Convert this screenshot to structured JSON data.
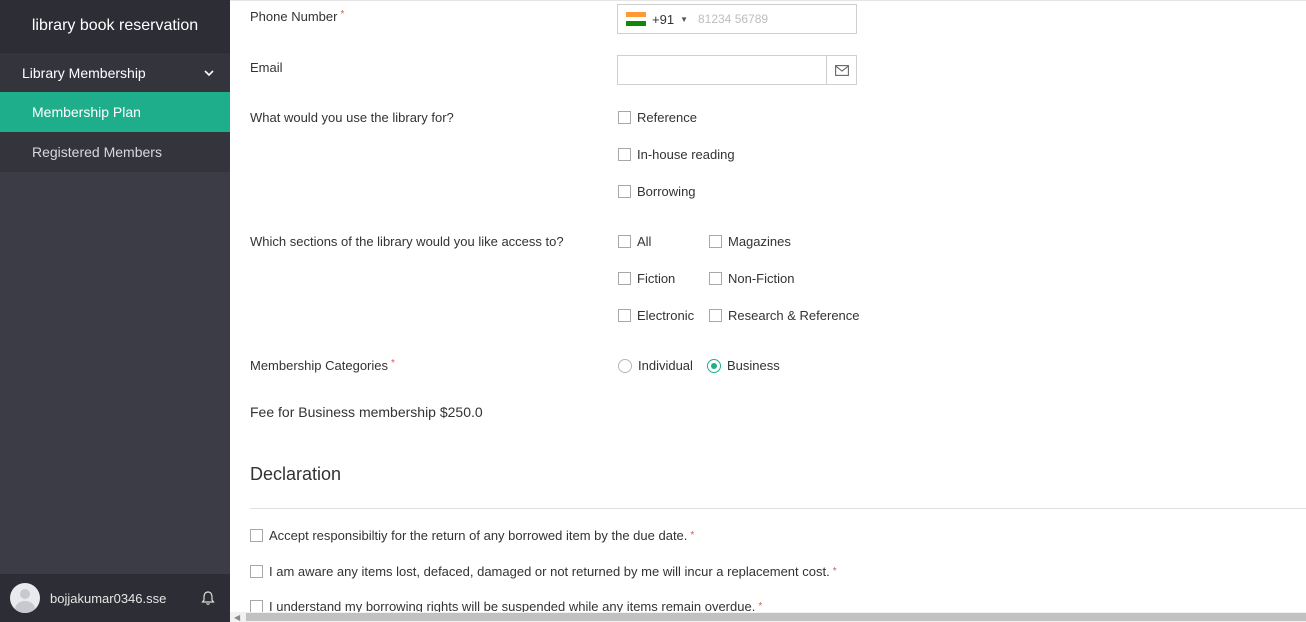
{
  "app": {
    "title": "library book reservation"
  },
  "sidebar": {
    "group_label": "Library Membership",
    "items": [
      {
        "label": "Membership Plan",
        "active": true
      },
      {
        "label": "Registered Members",
        "active": false
      }
    ],
    "user": "bojjakumar0346.sse"
  },
  "form": {
    "phone": {
      "label": "Phone Number",
      "required": "*",
      "country_code": "+91",
      "placeholder": "81234 56789"
    },
    "email": {
      "label": "Email",
      "value": ""
    },
    "use": {
      "label": "What would you use the library for?",
      "options": [
        "Reference",
        "In-house reading",
        "Borrowing"
      ]
    },
    "sections": {
      "label": "Which sections of the library would you like access to?",
      "options": [
        "All",
        "Magazines",
        "Fiction",
        "Non-Fiction",
        "Electronic",
        "Research & Reference"
      ]
    },
    "membership": {
      "label": "Membership Categories",
      "required": "*",
      "options": [
        "Individual",
        "Business"
      ],
      "selected": "Business"
    },
    "fee_text": "Fee for Business membership $250.0"
  },
  "declaration": {
    "title": "Declaration",
    "items": [
      "Accept responsibiltiy for the return of any borrowed item by the due date.",
      "I am aware any items lost, defaced, damaged or not returned by me will incur a replacement cost.",
      "I understand my borrowing rights will be suspended while any items remain overdue."
    ],
    "required": "*"
  },
  "colors": {
    "accent": "#1fae8c",
    "sidebar_bg": "#3c3c46",
    "sidebar_dark": "#2d2d35"
  },
  "icons": [
    "chevron-down-icon",
    "india-flag-icon",
    "envelope-icon",
    "bell-icon",
    "avatar-icon"
  ]
}
